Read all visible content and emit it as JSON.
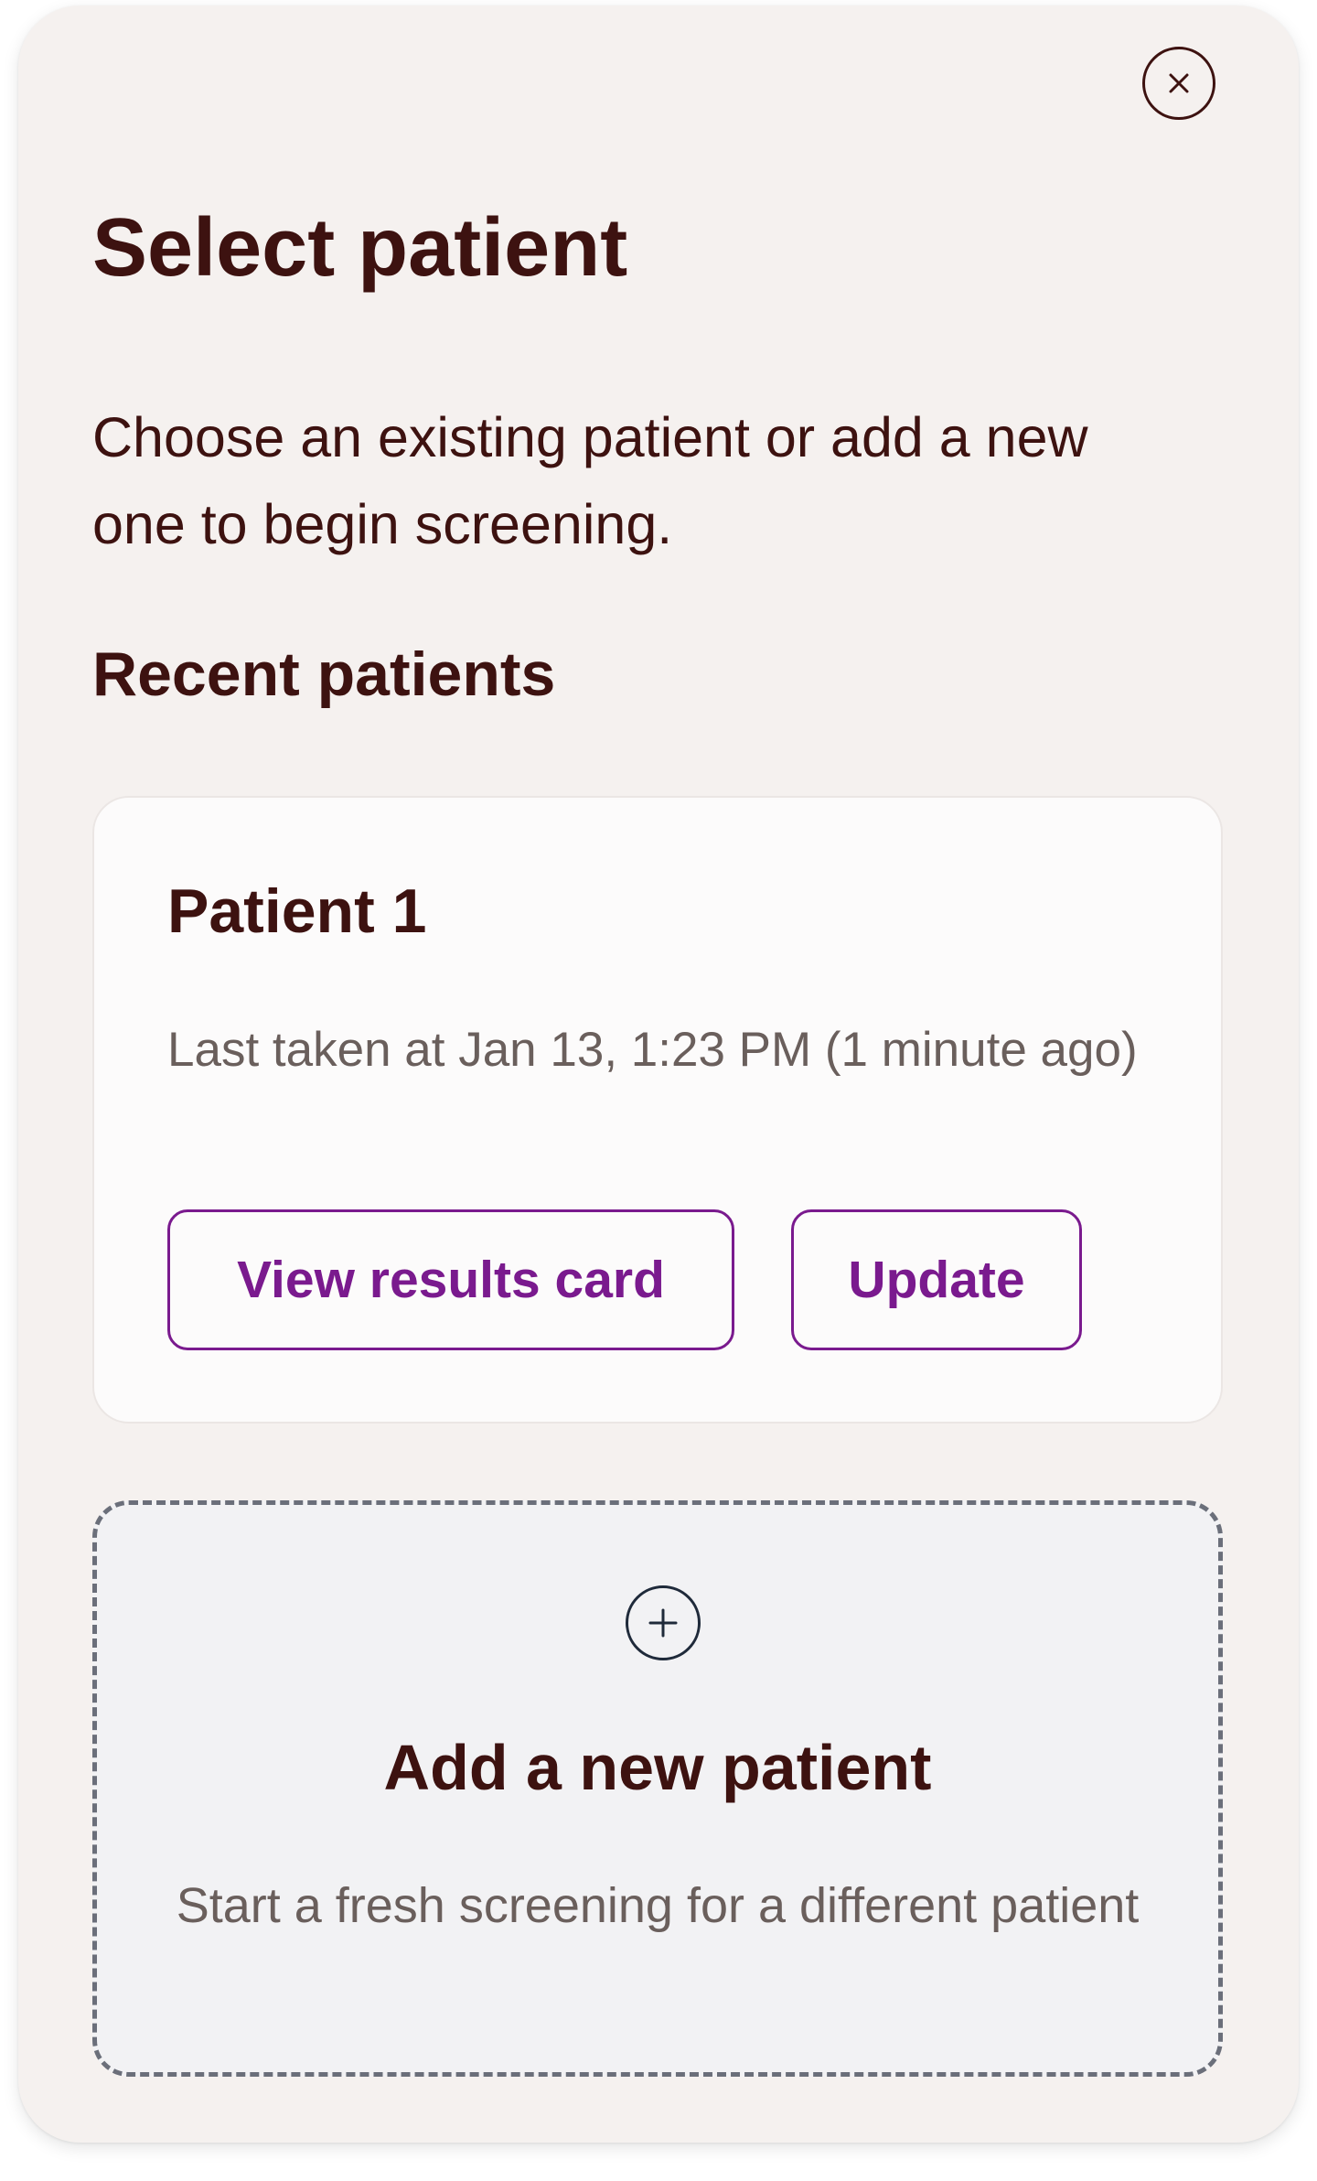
{
  "dialog": {
    "title": "Select patient",
    "subtitle": "Choose an existing patient or add a new one to begin screening.",
    "close_icon": "close-icon"
  },
  "recent": {
    "heading": "Recent patients",
    "patients": [
      {
        "name": "Patient 1",
        "last_taken": "Last taken at Jan 13, 1:23 PM (1 minute ago)",
        "view_label": "View results card",
        "update_label": "Update"
      }
    ]
  },
  "add_new": {
    "icon": "plus-circle-icon",
    "title": "Add a new patient",
    "description": "Start a fresh screening for a different patient"
  },
  "colors": {
    "background": "#f5f1ef",
    "text_primary": "#3d1210",
    "text_secondary": "#6a5f5c",
    "accent": "#7a1a8e",
    "dashed_border": "#6b6f7a"
  }
}
